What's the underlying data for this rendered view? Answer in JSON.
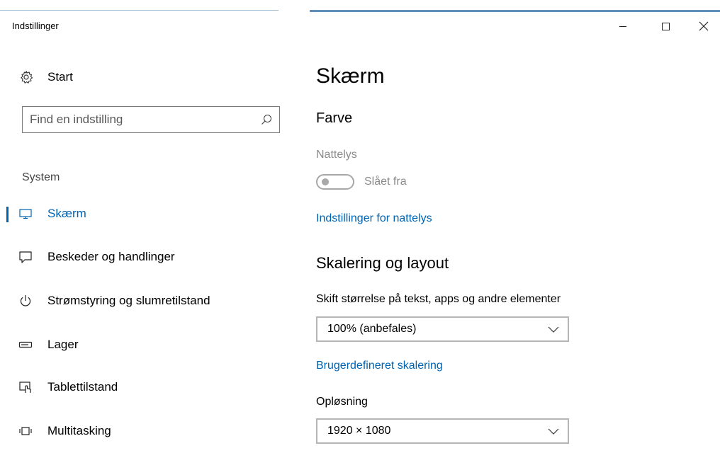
{
  "window": {
    "title": "Indstillinger"
  },
  "sidebar": {
    "home_label": "Start",
    "search": {
      "placeholder": "Find en indstilling"
    },
    "section_heading": "System",
    "items": [
      {
        "label": "Skærm",
        "icon": "monitor-icon",
        "active": true
      },
      {
        "label": "Beskeder og handlinger",
        "icon": "notifications-icon",
        "active": false
      },
      {
        "label": "Strømstyring og slumretilstand",
        "icon": "power-icon",
        "active": false
      },
      {
        "label": "Lager",
        "icon": "storage-icon",
        "active": false
      },
      {
        "label": "Tablettilstand",
        "icon": "tablet-mode-icon",
        "active": false
      },
      {
        "label": "Multitasking",
        "icon": "multitasking-icon",
        "active": false
      }
    ]
  },
  "content": {
    "page_title": "Skærm",
    "color_section": {
      "heading": "Farve",
      "night_light_label": "Nattelys",
      "night_light_state": "Slået fra",
      "night_light_settings_link": "Indstillinger for nattelys"
    },
    "scale_section": {
      "heading": "Skalering og layout",
      "scale_label": "Skift størrelse på tekst, apps og andre elementer",
      "scale_value": "100% (anbefales)",
      "custom_scaling_link": "Brugerdefineret skalering",
      "resolution_label": "Opløsning",
      "resolution_value": "1920 × 1080"
    }
  },
  "colors": {
    "accent": "#0063b1",
    "disabled_text": "#8a8a8a"
  }
}
